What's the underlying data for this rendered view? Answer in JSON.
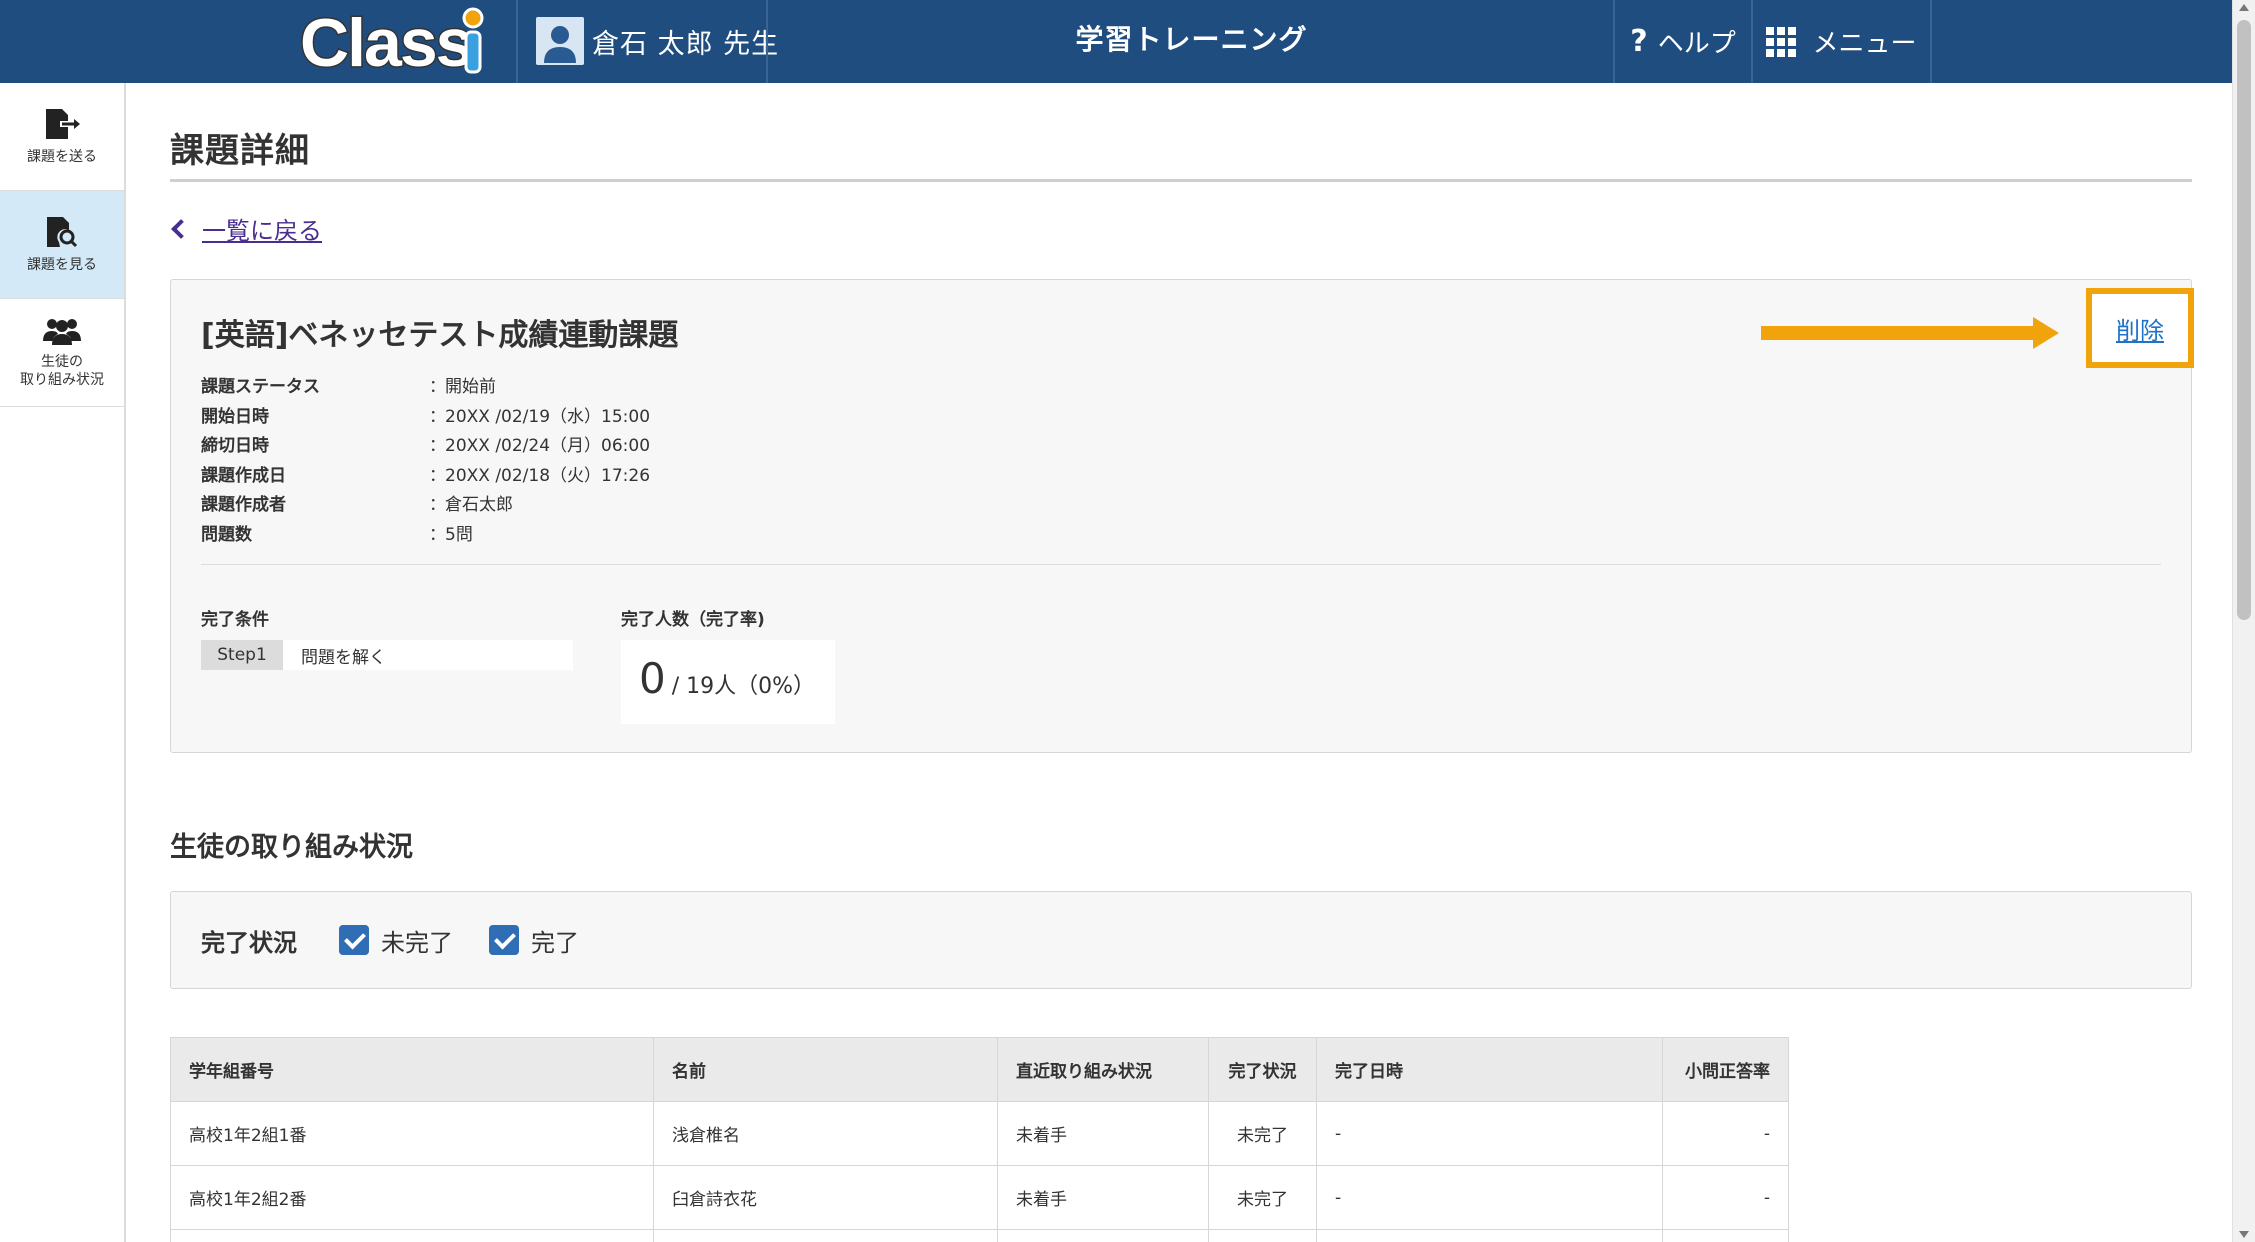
{
  "header": {
    "logo_text": "Classi",
    "user_name": "倉石 太郎 先生",
    "app_title": "学習トレーニング",
    "help_label": "ヘルプ",
    "menu_label": "メニュー",
    "color": "#1f4d7f"
  },
  "sidebar": {
    "items": [
      {
        "label": "課題を送る",
        "icon": "send-document-icon",
        "active": false
      },
      {
        "label": "課題を見る",
        "icon": "search-document-icon",
        "active": true
      },
      {
        "label_line1": "生徒の",
        "label_line2": "取り組み状況",
        "icon": "students-group-icon",
        "active": false
      }
    ]
  },
  "page": {
    "title": "課題詳細",
    "back_link": "一覧に戻る"
  },
  "task": {
    "title": "[英語]ベネッセテスト成績連動課題",
    "delete_label": "削除",
    "info": [
      {
        "label": "課題ステータス",
        "value": "開始前"
      },
      {
        "label": "開始日時",
        "value": "20XX /02/19（水）15:00"
      },
      {
        "label": "締切日時",
        "value": "20XX /02/24（月）06:00"
      },
      {
        "label": "課題作成日",
        "value": "20XX /02/18（火）17:26"
      },
      {
        "label": "課題作成者",
        "value": " 倉石太郎"
      },
      {
        "label": "問題数",
        "value": "5問"
      }
    ],
    "colon": "：",
    "completion_condition_label": "完了条件",
    "step_tag": "Step1",
    "step_text": "問題を解く",
    "completion_count_label": "完了人数（完了率)",
    "completed_count": "0",
    "completed_total": "/ 19人（0%）"
  },
  "status_section": {
    "title": "生徒の取り組み状況",
    "filter_label": "完了状況",
    "filters": [
      {
        "label": "未完了",
        "checked": true
      },
      {
        "label": "完了",
        "checked": true
      }
    ]
  },
  "table": {
    "headers": [
      "学年組番号",
      "名前",
      "直近取り組み状況",
      "完了状況",
      "完了日時",
      "小問正答率"
    ],
    "rows": [
      [
        "高校1年2組1番",
        "浅倉椎名",
        "未着手",
        "未完了",
        "-",
        "-"
      ],
      [
        "高校1年2組2番",
        "臼倉詩衣花",
        "未着手",
        "未完了",
        "-",
        "-"
      ]
    ]
  },
  "annotation": {
    "highlight_color": "#f0a30a"
  }
}
